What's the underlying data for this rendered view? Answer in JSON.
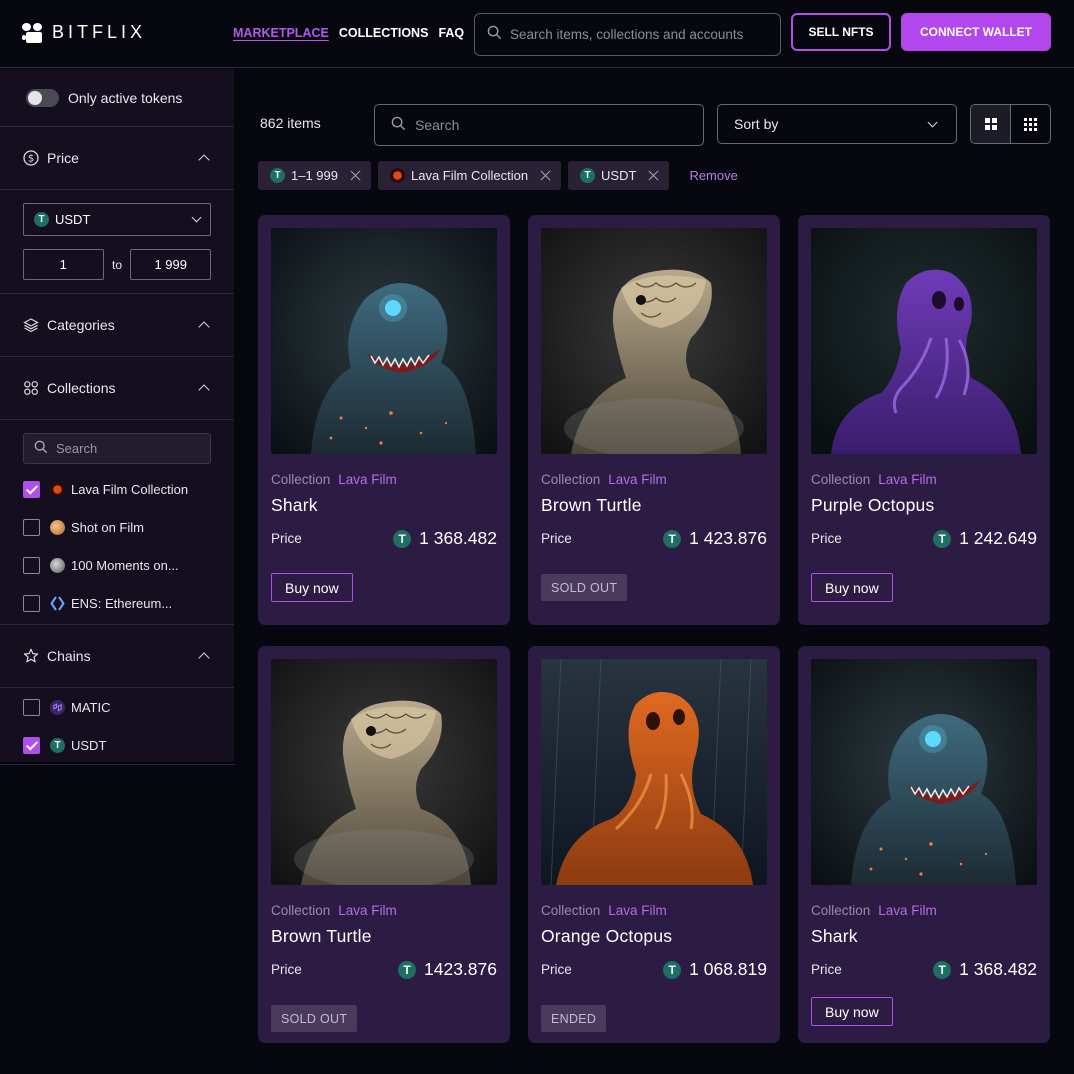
{
  "header": {
    "logo_text": "BITFLIX",
    "nav": [
      "MARKETPLACE",
      "COLLECTIONS",
      "FAQ"
    ],
    "search_placeholder": "Search items, collections and accounts",
    "sell_label": "SELL NFTS",
    "connect_label": "CONNECT WALLET"
  },
  "sidebar": {
    "active_toggle_label": "Only active tokens",
    "price": {
      "title": "Price",
      "currency": "USDT",
      "min": "1",
      "to_label": "to",
      "max": "1 999"
    },
    "categories_title": "Categories",
    "collections": {
      "title": "Collections",
      "search_placeholder": "Search",
      "items": [
        {
          "label": "Lava Film Collection",
          "checked": true
        },
        {
          "label": "Shot on Film",
          "checked": false
        },
        {
          "label": "100 Moments on...",
          "checked": false
        },
        {
          "label": "ENS: Ethereum...",
          "checked": false
        }
      ]
    },
    "chains": {
      "title": "Chains",
      "items": [
        {
          "label": "MATIC",
          "checked": false
        },
        {
          "label": "USDT",
          "checked": true
        }
      ]
    }
  },
  "toolbar": {
    "items_count": "862 items",
    "search_placeholder": "Search",
    "sort_label": "Sort by"
  },
  "filters": {
    "chips": [
      "1–1 999",
      "Lava Film Collection",
      "USDT"
    ],
    "remove_label": "Remove"
  },
  "cards": [
    {
      "collection_label": "Collection",
      "collection": "Lava Film",
      "name": "Shark",
      "price_label": "Price",
      "price": "1 368.482",
      "action": "Buy now",
      "status": "available",
      "art": "shark"
    },
    {
      "collection_label": "Collection",
      "collection": "Lava Film",
      "name": "Brown Turtle",
      "price_label": "Price",
      "price": "1 423.876",
      "action": "SOLD OUT",
      "status": "sold",
      "art": "turtle"
    },
    {
      "collection_label": "Collection",
      "collection": "Lava Film",
      "name": "Purple Octopus",
      "price_label": "Price",
      "price": "1 242.649",
      "action": "Buy now",
      "status": "available",
      "art": "purple-octopus"
    },
    {
      "collection_label": "Collection",
      "collection": "Lava Film",
      "name": "Brown Turtle",
      "price_label": "Price",
      "price": "1423.876",
      "action": "SOLD OUT",
      "status": "sold",
      "art": "turtle"
    },
    {
      "collection_label": "Collection",
      "collection": "Lava Film",
      "name": "Orange Octopus",
      "price_label": "Price",
      "price": "1 068.819",
      "action": "ENDED",
      "status": "ended",
      "art": "orange-octopus"
    },
    {
      "collection_label": "Collection",
      "collection": "Lava Film",
      "name": "Shark",
      "price_label": "Price",
      "price": "1 368.482",
      "action": "Buy now",
      "status": "available",
      "art": "shark"
    }
  ],
  "colors": {
    "accent": "#b147ec",
    "card_bg": "#2c1b42",
    "sidebar_bg": "#140e1e",
    "page_bg": "#07070f",
    "tether": "#1f6e62"
  },
  "icons": [
    "search-icon",
    "dollar-circle-icon",
    "layers-icon",
    "grid-four-icon",
    "star-icon",
    "chevron-up-icon",
    "chevron-down-icon",
    "tether-icon",
    "close-icon",
    "grid-large-icon",
    "grid-small-icon"
  ]
}
